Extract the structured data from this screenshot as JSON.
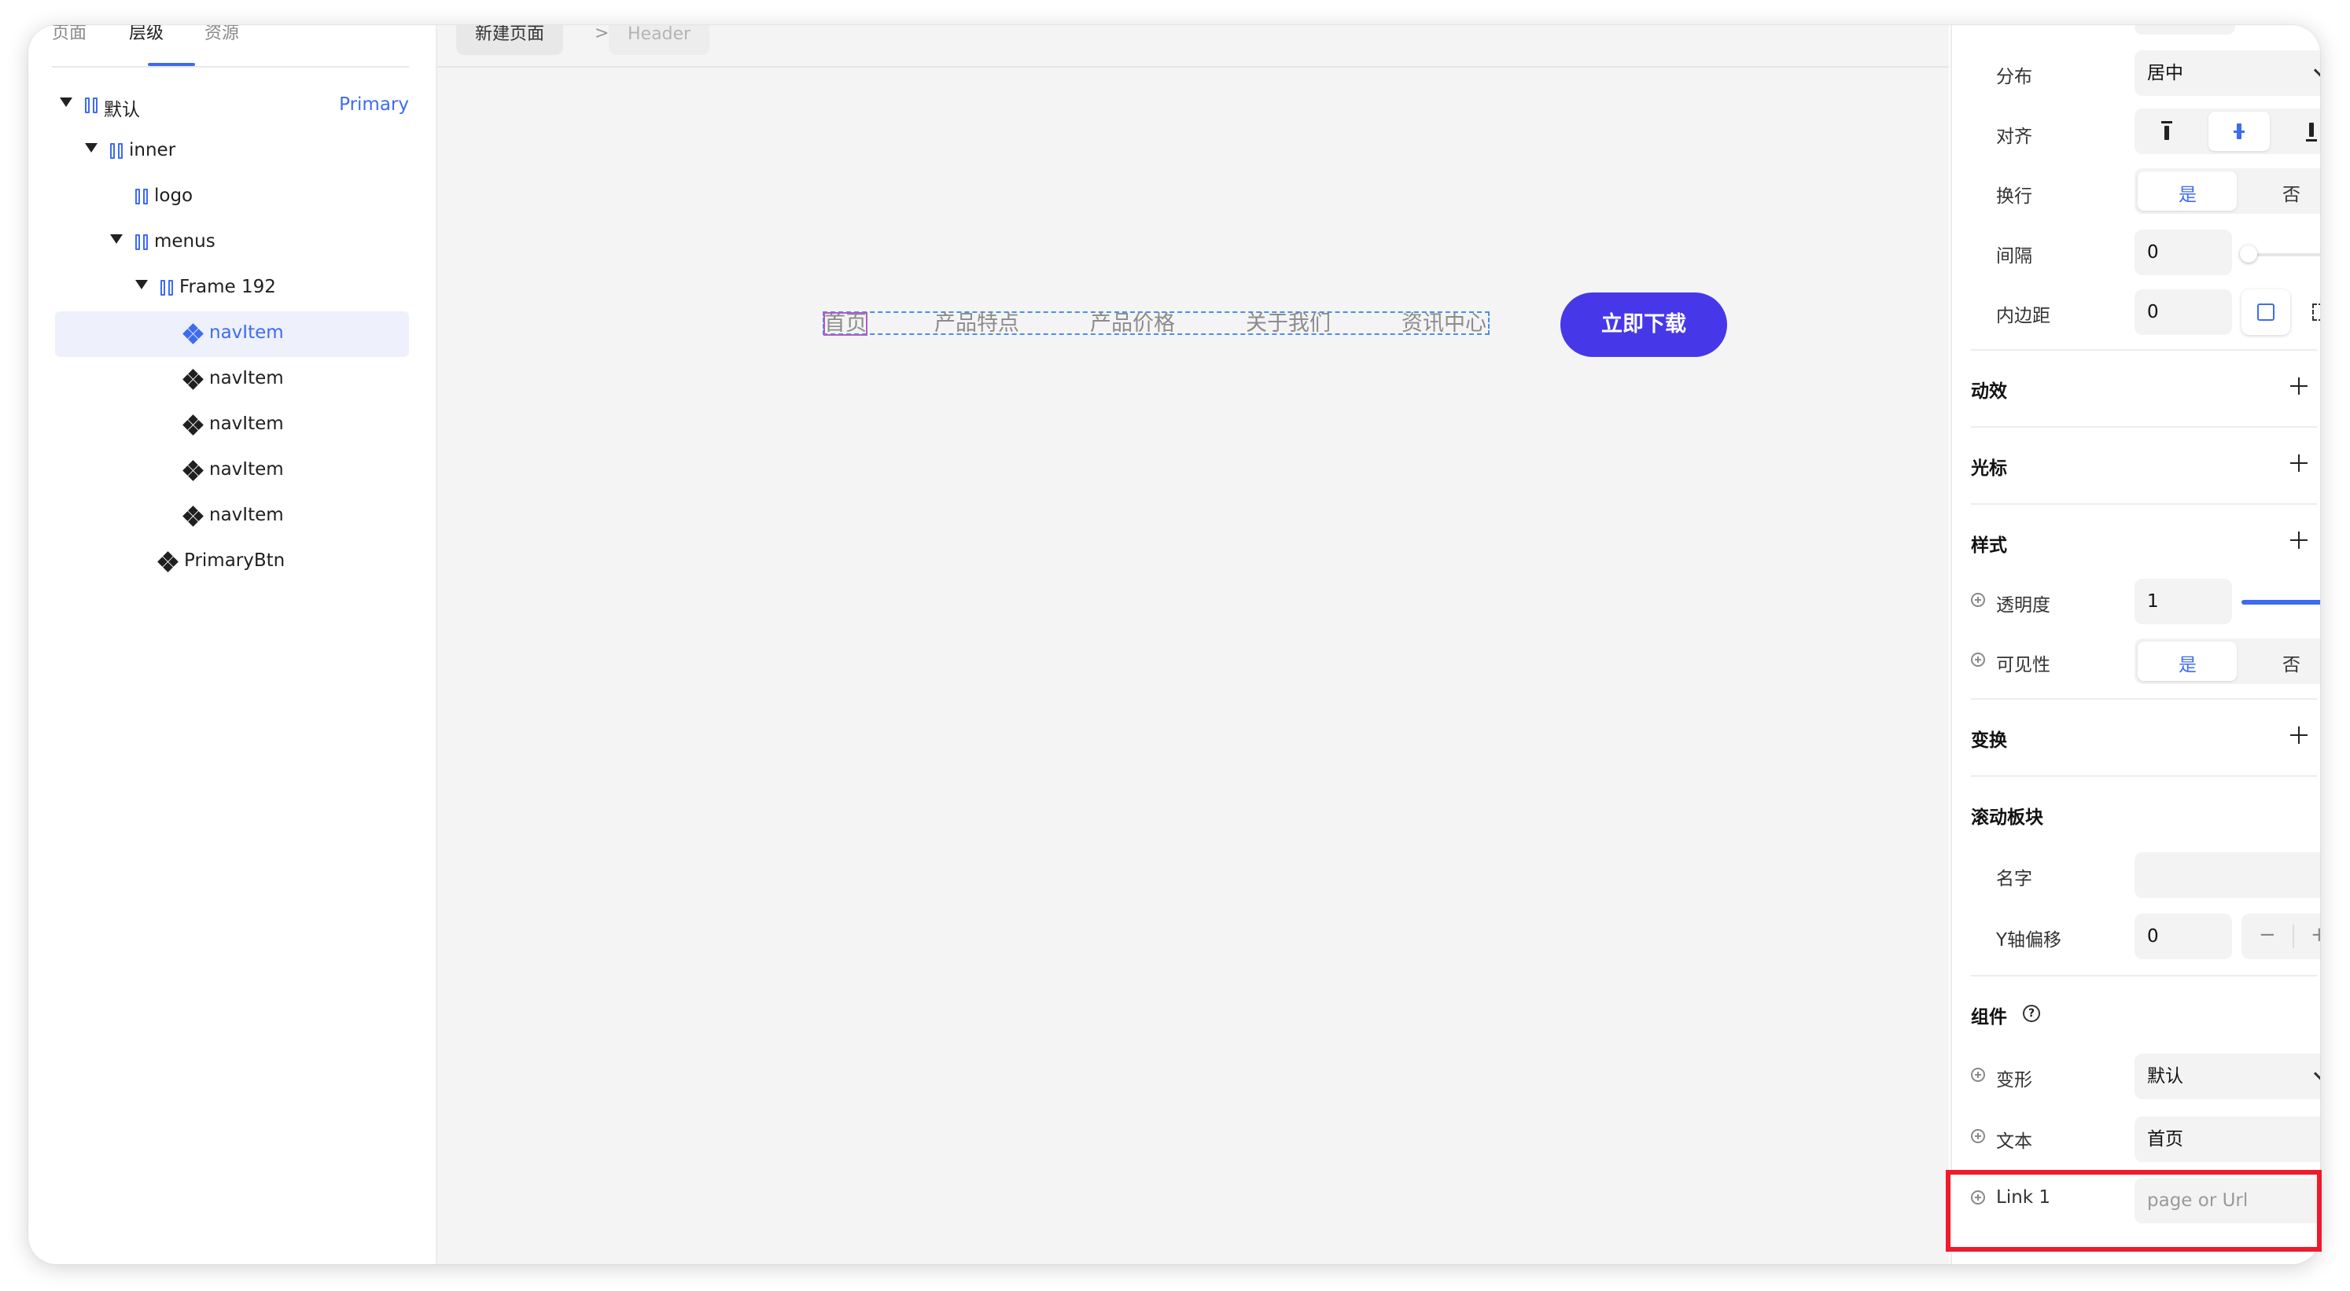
{
  "left_panel": {
    "tabs": [
      "页面",
      "层级",
      "资源"
    ],
    "active_tab": 1,
    "tree": [
      {
        "label": "默认",
        "badge": "Primary",
        "icon": "frame-icon",
        "expand": true
      },
      {
        "label": "inner",
        "icon": "frame-icon",
        "expand": true
      },
      {
        "label": "logo",
        "icon": "frame-icon"
      },
      {
        "label": "menus",
        "icon": "frame-icon",
        "expand": true
      },
      {
        "label": "Frame 192",
        "icon": "frame-icon",
        "expand": true
      },
      {
        "label": "navItem",
        "icon": "component-icon",
        "selected": true
      },
      {
        "label": "navItem",
        "icon": "component-icon"
      },
      {
        "label": "navItem",
        "icon": "component-icon"
      },
      {
        "label": "navItem",
        "icon": "component-icon"
      },
      {
        "label": "navItem",
        "icon": "component-icon"
      },
      {
        "label": "PrimaryBtn",
        "icon": "component-icon"
      }
    ]
  },
  "canvas": {
    "breadcrumb": [
      "新建页面",
      "Header"
    ],
    "separator": ">",
    "nav_items": [
      "首页",
      "产品特点",
      "产品价格",
      "关于我们",
      "资讯中心"
    ],
    "cta_label": "立即下载"
  },
  "props": {
    "distribution": {
      "label": "分布",
      "value": "居中"
    },
    "align": {
      "label": "对齐",
      "selected": "center"
    },
    "wrap": {
      "label": "换行",
      "options": [
        "是",
        "否"
      ],
      "selected": 0
    },
    "gap": {
      "label": "间隔",
      "value": "0"
    },
    "padding": {
      "label": "内边距",
      "value": "0"
    },
    "sections": {
      "motion": "动效",
      "cursor": "光标",
      "style": "样式",
      "transform": "变换",
      "scroll": "滚动板块",
      "component": "组件"
    },
    "opacity": {
      "label": "透明度",
      "value": "1",
      "level": 1.0
    },
    "visibility": {
      "label": "可见性",
      "options": [
        "是",
        "否"
      ],
      "selected": 0
    },
    "scroll_name": {
      "label": "名字",
      "value": ""
    },
    "y_offset": {
      "label": "Y轴偏移",
      "value": "0",
      "minus": "−",
      "plus": "+"
    },
    "variant": {
      "label": "变形",
      "value": "默认"
    },
    "text": {
      "label": "文本",
      "value": "首页"
    },
    "link": {
      "label": "Link 1",
      "placeholder": "page or Url"
    }
  },
  "colors": {
    "accent": "#3d6cf0",
    "cta": "#4638e8",
    "highlight": "#ee1b2b"
  }
}
